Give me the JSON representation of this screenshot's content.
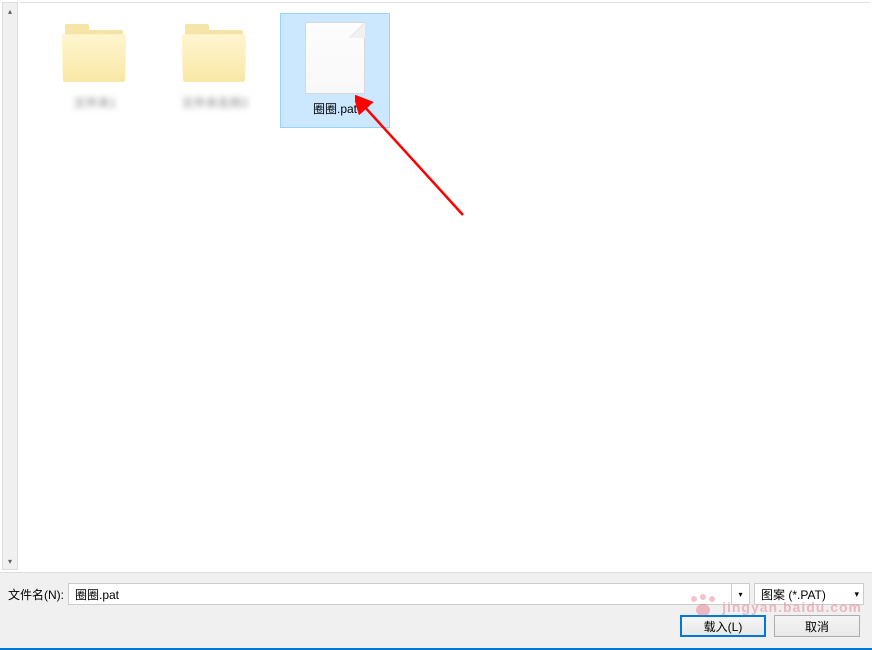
{
  "items": [
    {
      "type": "folder",
      "label": "文件夹1",
      "blurred": true,
      "selected": false
    },
    {
      "type": "folder",
      "label": "文件夹名称2",
      "blurred": true,
      "selected": false
    },
    {
      "type": "file",
      "label": "圈圈.pat",
      "blurred": false,
      "selected": true
    }
  ],
  "bottom": {
    "filename_label": "文件名(N):",
    "filename_value": "圈圈.pat",
    "filter_label": "图案 (*.PAT)",
    "load_button": "载入(L)",
    "cancel_button": "取消"
  },
  "watermark": {
    "text": "jingyan.baidu.com"
  }
}
